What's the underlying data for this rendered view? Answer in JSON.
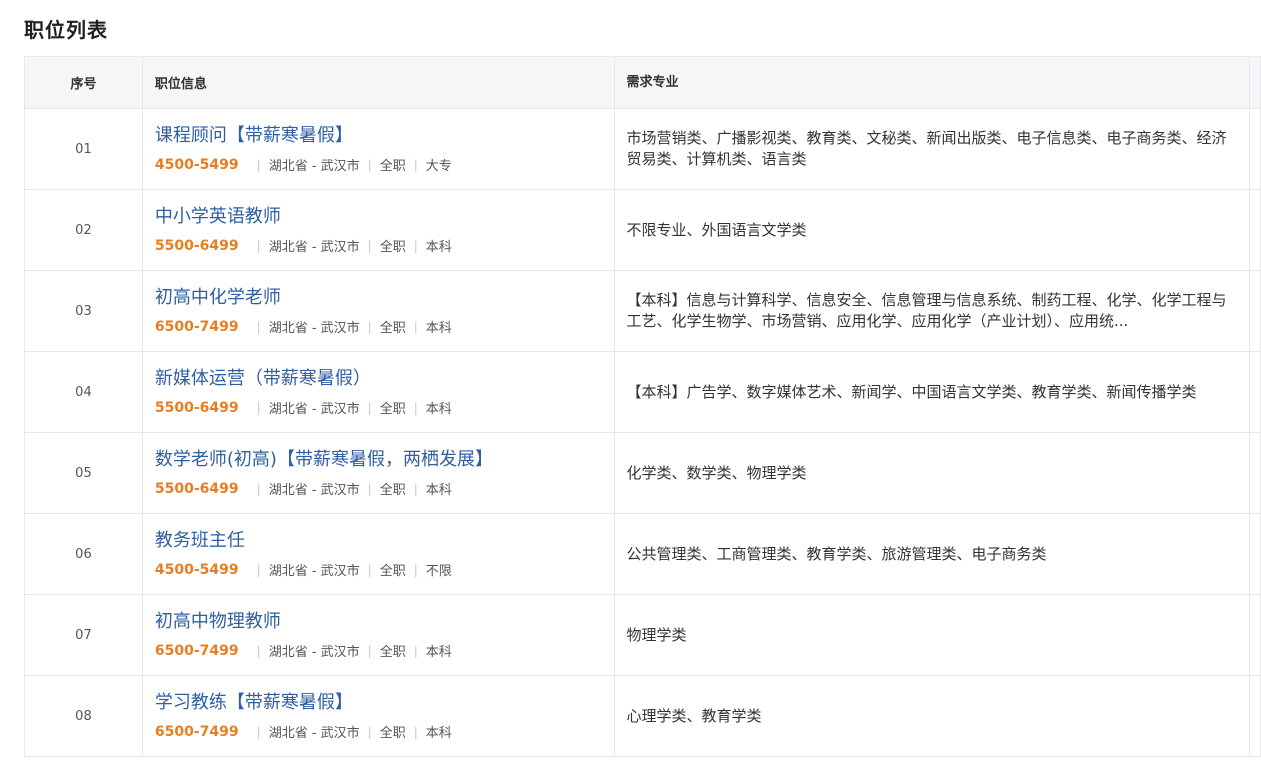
{
  "page_title": "职位列表",
  "columns": {
    "no": "序号",
    "info": "职位信息",
    "major": "需求专业"
  },
  "separator": "|",
  "rows": [
    {
      "no": "01",
      "title": "课程顾问【带薪寒暑假】",
      "salary": "4500-5499",
      "location": "湖北省 - 武汉市",
      "type": "全职",
      "education": "大专",
      "major": "市场营销类、广播影视类、教育类、文秘类、新闻出版类、电子信息类、电子商务类、经济贸易类、计算机类、语言类"
    },
    {
      "no": "02",
      "title": "中小学英语教师",
      "salary": "5500-6499",
      "location": "湖北省 - 武汉市",
      "type": "全职",
      "education": "本科",
      "major": "不限专业、外国语言文学类"
    },
    {
      "no": "03",
      "title": "初高中化学老师",
      "salary": "6500-7499",
      "location": "湖北省 - 武汉市",
      "type": "全职",
      "education": "本科",
      "major": "【本科】信息与计算科学、信息安全、信息管理与信息系统、制药工程、化学、化学工程与工艺、化学生物学、市场营销、应用化学、应用化学（产业计划）、应用统..."
    },
    {
      "no": "04",
      "title": "新媒体运营（带薪寒暑假）",
      "salary": "5500-6499",
      "location": "湖北省 - 武汉市",
      "type": "全职",
      "education": "本科",
      "major": "【本科】广告学、数字媒体艺术、新闻学、中国语言文学类、教育学类、新闻传播学类"
    },
    {
      "no": "05",
      "title": "数学老师(初高)【带薪寒暑假，两栖发展】",
      "salary": "5500-6499",
      "location": "湖北省 - 武汉市",
      "type": "全职",
      "education": "本科",
      "major": "化学类、数学类、物理学类"
    },
    {
      "no": "06",
      "title": "教务班主任",
      "salary": "4500-5499",
      "location": "湖北省 - 武汉市",
      "type": "全职",
      "education": "不限",
      "major": "公共管理类、工商管理类、教育学类、旅游管理类、电子商务类"
    },
    {
      "no": "07",
      "title": "初高中物理教师",
      "salary": "6500-7499",
      "location": "湖北省 - 武汉市",
      "type": "全职",
      "education": "本科",
      "major": "物理学类"
    },
    {
      "no": "08",
      "title": "学习教练【带薪寒暑假】",
      "salary": "6500-7499",
      "location": "湖北省 - 武汉市",
      "type": "全职",
      "education": "本科",
      "major": "心理学类、教育学类"
    }
  ]
}
